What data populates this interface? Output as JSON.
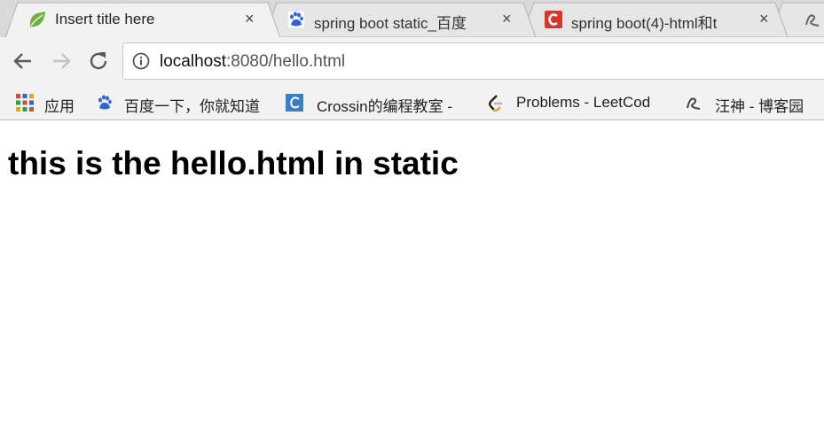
{
  "tabs": [
    {
      "title": "Insert title here",
      "icon": "spring-leaf-icon",
      "active": true
    },
    {
      "title": "spring boot static_百度",
      "icon": "baidu-paw-icon",
      "active": false
    },
    {
      "title": "spring boot(4)-html和t",
      "icon": "csdn-c-icon",
      "active": false
    },
    {
      "title": "",
      "icon": "cnblogs-icon",
      "active": false
    }
  ],
  "close_glyph": "×",
  "omnibox": {
    "host": "localhost",
    "path": ":8080/hello.html"
  },
  "bookmarks": [
    {
      "label": "应用",
      "icon": "apps-grid-icon"
    },
    {
      "label": "百度一下，你就知道",
      "icon": "baidu-paw-icon"
    },
    {
      "label": "Crossin的编程教室 -",
      "icon": "crossin-c-icon"
    },
    {
      "label": "Problems - LeetCod",
      "icon": "leetcode-icon"
    },
    {
      "label": "汪神 - 博客园",
      "icon": "cnblogs-icon"
    }
  ],
  "page": {
    "heading": "this is the hello.html in static"
  },
  "colors": {
    "baidu": "#2f63d6",
    "csdn": "#d9352c",
    "spring": "#6db33f"
  }
}
